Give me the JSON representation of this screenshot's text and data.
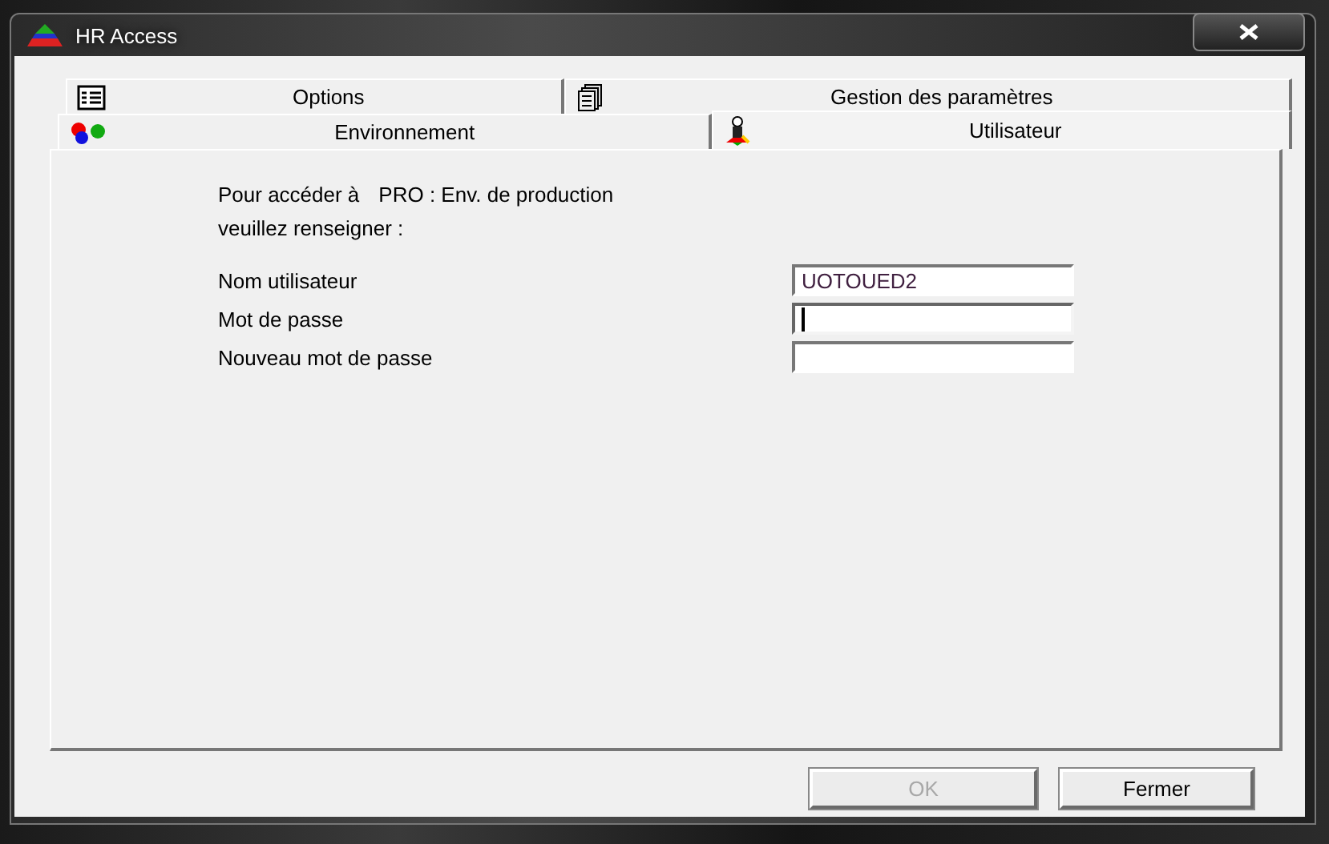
{
  "window": {
    "title": "HR Access"
  },
  "tab_rows": [
    [
      {
        "label": "Options",
        "kind": "list",
        "selected": false
      },
      {
        "label": "Gestion des paramètres",
        "kind": "pages",
        "selected": false
      }
    ],
    [
      {
        "label": "Environnement",
        "kind": "dots",
        "selected": false
      },
      {
        "label": "Utilisateur",
        "kind": "user",
        "selected": true
      }
    ]
  ],
  "intro": {
    "prefix": "Pour accéder à",
    "environment": "PRO : Env. de production",
    "line_2": "veuillez renseigner :"
  },
  "fields": [
    {
      "label": "Nom utilisateur",
      "value": "UOTOUED2",
      "focused": false
    },
    {
      "label": "Mot de passe",
      "focused": true
    },
    {
      "label": "Nouveau mot de passe",
      "focused": false
    }
  ],
  "buttons": [
    {
      "label": "OK",
      "disabled": true
    },
    {
      "label": "Fermer",
      "disabled": false
    }
  ]
}
